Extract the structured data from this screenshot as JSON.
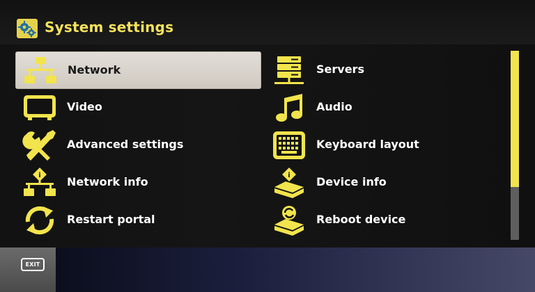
{
  "header": {
    "title": "System settings",
    "icon": "gears-icon"
  },
  "menu": {
    "left": [
      {
        "label": "Network",
        "icon": "network-icon",
        "selected": true
      },
      {
        "label": "Video",
        "icon": "monitor-icon"
      },
      {
        "label": "Advanced settings",
        "icon": "tools-icon"
      },
      {
        "label": "Network info",
        "icon": "network-info-icon"
      },
      {
        "label": "Restart portal",
        "icon": "restart-icon"
      }
    ],
    "right": [
      {
        "label": "Servers",
        "icon": "servers-icon"
      },
      {
        "label": "Audio",
        "icon": "music-note-icon"
      },
      {
        "label": "Keyboard layout",
        "icon": "keyboard-icon"
      },
      {
        "label": "Device info",
        "icon": "device-info-icon"
      },
      {
        "label": "Reboot device",
        "icon": "reboot-icon"
      }
    ]
  },
  "footer": {
    "exit_label": "EXIT"
  },
  "colors": {
    "accent": "#f2e44c",
    "selected_bg": "#dcd7cf",
    "title": "#f4e25b"
  }
}
